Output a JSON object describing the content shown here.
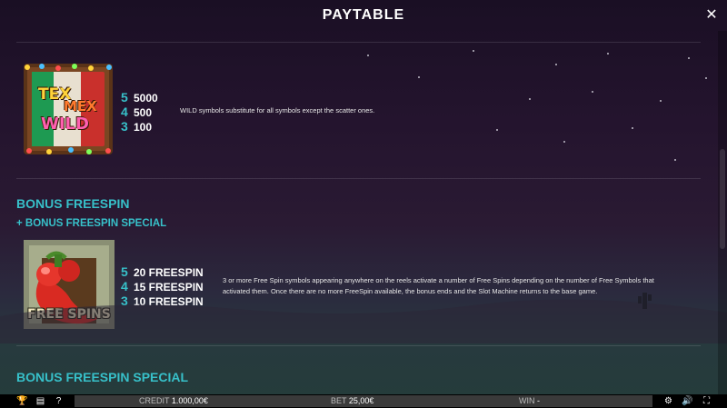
{
  "header": {
    "title": "PAYTABLE",
    "close_icon": "close-icon"
  },
  "wild": {
    "symbol_text": [
      "TEX",
      "MEX",
      "WILD"
    ],
    "pays": [
      {
        "count": "5",
        "value": "5000"
      },
      {
        "count": "4",
        "value": "500"
      },
      {
        "count": "3",
        "value": "100"
      }
    ],
    "description": "WILD symbols substitute for all symbols except the scatter ones."
  },
  "bonus_freespin": {
    "title": "BONUS FREESPIN",
    "subtitle": "+ BONUS FREESPIN SPECIAL",
    "symbol_text": "FREE SPINS",
    "pays": [
      {
        "count": "5",
        "value": "20 FREESPIN"
      },
      {
        "count": "4",
        "value": "15 FREESPIN"
      },
      {
        "count": "3",
        "value": "10 FREESPIN"
      }
    ],
    "description_line1": "3 or more Free Spin symbols appearing anywhere on the reels activate a number of Free Spins depending on the number of Free Symbols that",
    "description_line2": "activated them. Once there are no more FreeSpin available, the bonus ends and the Slot Machine returns to the base game."
  },
  "bonus_freespin_special": {
    "title": "BONUS FREESPIN SPECIAL"
  },
  "footer": {
    "credit_label": "CREDIT",
    "credit_value": "1.000,00€",
    "bet_label": "BET",
    "bet_value": "25,00€",
    "win_label": "WIN",
    "win_value": "-",
    "icons": [
      "trophy-icon",
      "paytable-icon",
      "help-icon",
      "settings-icon",
      "sound-icon",
      "fullscreen-icon"
    ]
  },
  "colors": {
    "accent": "#37c0c9",
    "background_top": "#1a0f24",
    "background_bottom": "#243c3a"
  }
}
